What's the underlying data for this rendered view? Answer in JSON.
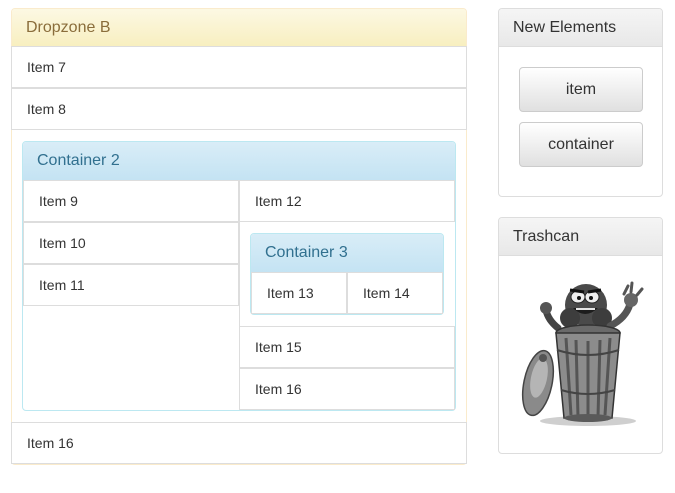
{
  "dropzone": {
    "title": "Dropzone B",
    "items": [
      "Item 7",
      "Item 8"
    ],
    "last_item": "Item 16"
  },
  "container2": {
    "title": "Container 2",
    "left_items": [
      "Item 9",
      "Item 10",
      "Item 11"
    ],
    "right_top_item": "Item 12",
    "right_bottom_items": [
      "Item 15",
      "Item 16"
    ]
  },
  "container3": {
    "title": "Container 3",
    "items": [
      "Item 13",
      "Item 14"
    ]
  },
  "new_elements": {
    "title": "New Elements",
    "buttons": [
      "item",
      "container"
    ]
  },
  "trashcan": {
    "title": "Trashcan",
    "image_icon": "trashcan-monster-icon"
  },
  "colors": {
    "warning_text": "#8a6d3b",
    "warning_bg": "#fcf8e3",
    "warning_border": "#faebcc",
    "info_text": "#31708f",
    "info_bg": "#d9edf7",
    "info_border": "#bce8f1"
  }
}
